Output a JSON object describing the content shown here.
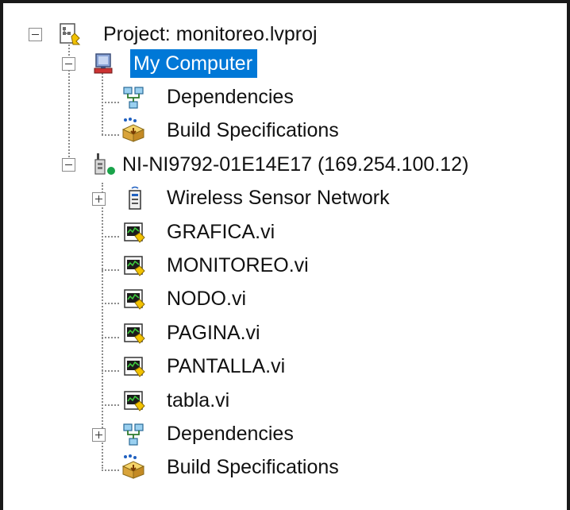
{
  "tree": {
    "items": [
      {
        "label": "Project: monitoreo.lvproj",
        "icon": "project-icon",
        "expanded": true
      },
      {
        "label": "My Computer",
        "icon": "my-computer-icon",
        "expanded": true,
        "selected": true
      },
      {
        "label": "Dependencies",
        "icon": "dependencies-icon"
      },
      {
        "label": "Build Specifications",
        "icon": "build-specifications-icon"
      },
      {
        "label": "NI-NI9792-01E14E17 (169.254.100.12)",
        "icon": "ni-target-icon",
        "expanded": true
      },
      {
        "label": "Wireless Sensor Network",
        "icon": "wireless-sensor-network-icon",
        "expanded": false
      },
      {
        "label": "GRAFICA.vi",
        "icon": "vi-file-icon"
      },
      {
        "label": "MONITOREO.vi",
        "icon": "vi-file-icon"
      },
      {
        "label": "NODO.vi",
        "icon": "vi-file-icon"
      },
      {
        "label": "PAGINA.vi",
        "icon": "vi-file-icon"
      },
      {
        "label": "PANTALLA.vi",
        "icon": "vi-file-icon"
      },
      {
        "label": "tabla.vi",
        "icon": "vi-file-icon"
      },
      {
        "label": "Dependencies",
        "icon": "dependencies-icon",
        "expanded": false
      },
      {
        "label": "Build Specifications",
        "icon": "build-specifications-icon"
      }
    ]
  },
  "colors": {
    "selection": "#0078d7",
    "status_online": "#1aa34a"
  }
}
